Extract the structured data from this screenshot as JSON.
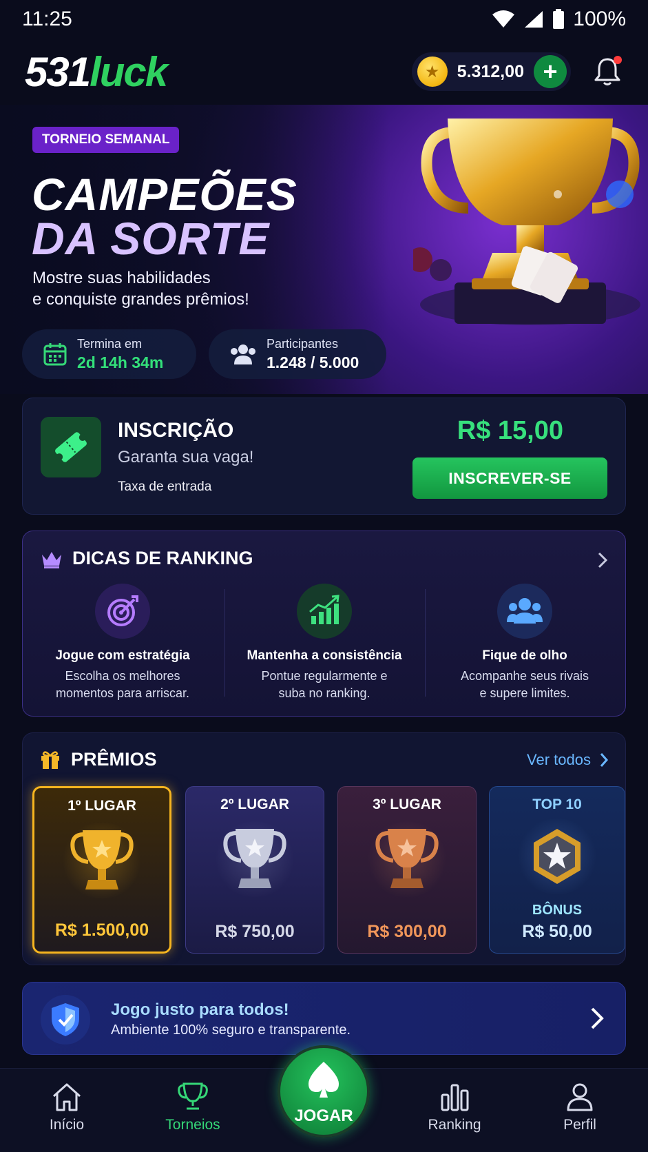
{
  "status_bar": {
    "time": "11:25",
    "battery": "100%"
  },
  "header": {
    "logo_number": "531",
    "logo_word": "luck",
    "balance": "5.312,00"
  },
  "hero": {
    "badge": "TORNEIO SEMANAL",
    "title_line1": "CAMPEÕES",
    "title_line2": "DA SORTE",
    "subtitle_line1": "Mostre suas habilidades",
    "subtitle_line2": "e conquiste grandes prêmios!",
    "ends_label": "Termina em",
    "ends_value": "2d 14h 34m",
    "participants_label": "Participantes",
    "participants_value": "1.248 / 5.000"
  },
  "inscricao": {
    "title": "INSCRIÇÃO",
    "subtitle": "Garanta sua vaga!",
    "fee_label": "Taxa de entrada",
    "price": "R$ 15,00",
    "button": "INSCREVER-SE"
  },
  "dicas": {
    "title": "DICAS DE RANKING",
    "tips": [
      {
        "title": "Jogue com estratégia",
        "line1": "Escolha os melhores",
        "line2": "momentos para arriscar.",
        "icon": "target-icon"
      },
      {
        "title": "Mantenha a consistência",
        "line1": "Pontue regularmente e",
        "line2": "suba no ranking.",
        "icon": "growth-chart-icon"
      },
      {
        "title": "Fique de olho",
        "line1": "Acompanhe seus rivais",
        "line2": "e supere limites.",
        "icon": "users-icon"
      }
    ]
  },
  "premios": {
    "title": "PRÊMIOS",
    "see_all": "Ver todos",
    "prizes": [
      {
        "label": "1º LUGAR",
        "value": "R$ 1.500,00"
      },
      {
        "label": "2º LUGAR",
        "value": "R$ 750,00"
      },
      {
        "label": "3º LUGAR",
        "value": "R$ 300,00"
      },
      {
        "label": "TOP 10",
        "bonus": "BÔNUS",
        "value": "R$ 50,00"
      }
    ]
  },
  "fair_play": {
    "title": "Jogo justo para todos!",
    "subtitle": "Ambiente 100% seguro e transparente."
  },
  "nav": {
    "home": "Início",
    "tournaments": "Torneios",
    "play": "JOGAR",
    "ranking": "Ranking",
    "profile": "Perfil"
  },
  "colors": {
    "accent_green": "#2fd160",
    "purple": "#6a22c9",
    "gold": "#f6b51f",
    "background": "#0a0c1c"
  }
}
